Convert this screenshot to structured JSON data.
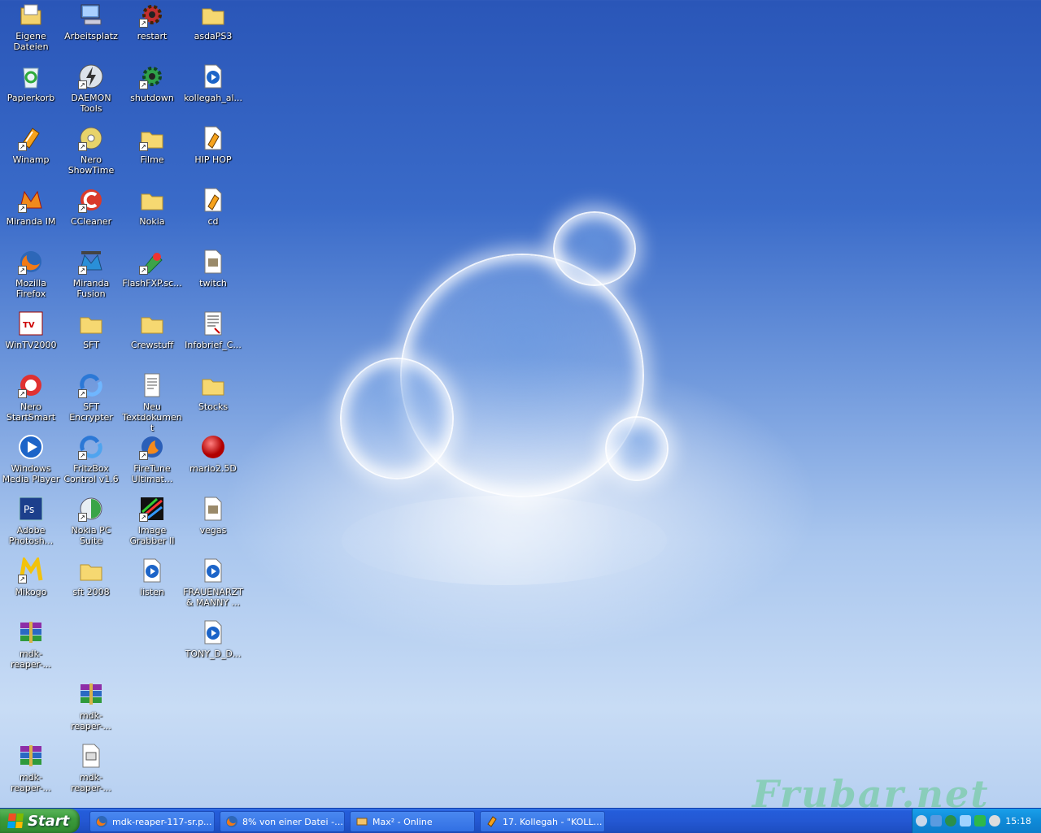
{
  "desktop": {
    "icons": [
      {
        "label": "Eigene Dateien",
        "icon": "my-documents-icon"
      },
      {
        "label": "Arbeitsplatz",
        "icon": "my-computer-icon"
      },
      {
        "label": "restart",
        "icon": "gear-shortcut-icon"
      },
      {
        "label": "asdaPS3",
        "icon": "folder-icon"
      },
      {
        "label": "Papierkorb",
        "icon": "recycle-bin-icon"
      },
      {
        "label": "DAEMON Tools",
        "icon": "daemon-tools-icon"
      },
      {
        "label": "shutdown",
        "icon": "gear-shortcut-icon"
      },
      {
        "label": "kollegah_al...",
        "icon": "media-file-icon"
      },
      {
        "label": "Winamp",
        "icon": "winamp-icon"
      },
      {
        "label": "Nero ShowTime",
        "icon": "nero-showtime-icon"
      },
      {
        "label": "Filme",
        "icon": "folder-icon"
      },
      {
        "label": "HIP HOP",
        "icon": "playlist-file-icon"
      },
      {
        "label": "Miranda IM",
        "icon": "miranda-icon"
      },
      {
        "label": "CCleaner",
        "icon": "ccleaner-icon"
      },
      {
        "label": "Nokia",
        "icon": "folder-icon"
      },
      {
        "label": "cd",
        "icon": "playlist-file-icon"
      },
      {
        "label": "Mozilla Firefox",
        "icon": "firefox-icon"
      },
      {
        "label": "Miranda Fusion",
        "icon": "miranda-fusion-icon"
      },
      {
        "label": "FlashFXP.sc...",
        "icon": "flashfxp-icon"
      },
      {
        "label": "twitch",
        "icon": "image-file-icon"
      },
      {
        "label": "WinTV2000",
        "icon": "wintv-icon"
      },
      {
        "label": "SFT",
        "icon": "folder-icon"
      },
      {
        "label": "Crewstuff",
        "icon": "folder-icon"
      },
      {
        "label": "Infobrief_C...",
        "icon": "document-icon"
      },
      {
        "label": "Nero StartSmart",
        "icon": "nero-startsmart-icon"
      },
      {
        "label": "SFT Encrypter",
        "icon": "sft-encrypter-icon"
      },
      {
        "label": "Neu Textdokument",
        "icon": "text-file-icon"
      },
      {
        "label": "Stocks",
        "icon": "folder-icon"
      },
      {
        "label": "Windows Media Player",
        "icon": "media-player-icon"
      },
      {
        "label": "FritzBox Control v1.6",
        "icon": "fritzbox-icon"
      },
      {
        "label": "FireTune Ultimat...",
        "icon": "firetune-icon"
      },
      {
        "label": "mario2.5D",
        "icon": "red-ball-icon"
      },
      {
        "label": "Adobe Photosh...",
        "icon": "photoshop-icon"
      },
      {
        "label": "Nokia PC Suite",
        "icon": "nokia-pc-suite-icon"
      },
      {
        "label": "Image Grabber II",
        "icon": "image-grabber-icon"
      },
      {
        "label": "vegas",
        "icon": "image-file-icon"
      },
      {
        "label": "Mikogo",
        "icon": "mikogo-icon"
      },
      {
        "label": "sft 2008",
        "icon": "folder-icon"
      },
      {
        "label": "listen",
        "icon": "media-file-icon"
      },
      {
        "label": "FRAUENARZT & MANNY ...",
        "icon": "media-file-icon"
      },
      {
        "label": "mdk-reaper-...",
        "icon": "winrar-archive-icon"
      },
      {
        "label": "TONY_D_D...",
        "icon": "media-file-icon"
      },
      {
        "label": "mdk-reaper-...",
        "icon": "winrar-archive-icon"
      },
      {
        "label": "mdk-reaper-...",
        "icon": "winrar-archive-icon"
      },
      {
        "label": "mdk-reaper-...",
        "icon": "exe-file-icon"
      }
    ],
    "watermark": "Frubar.net"
  },
  "taskbar": {
    "start_label": "Start",
    "tasks": [
      {
        "label": "mdk-reaper-117-sr.p...",
        "icon": "firefox-icon"
      },
      {
        "label": "8% von einer Datei - ...",
        "icon": "firefox-icon"
      },
      {
        "label": "Max² - Online",
        "icon": "messenger-icon"
      },
      {
        "label": "17. Kollegah - \"KOLLE...",
        "icon": "winamp-icon"
      }
    ],
    "tray_icons": [
      "tray-back-icon",
      "network-icon",
      "globe-icon",
      "wifi-icon",
      "signal-icon",
      "speaker-icon"
    ],
    "clock": "15:18"
  }
}
